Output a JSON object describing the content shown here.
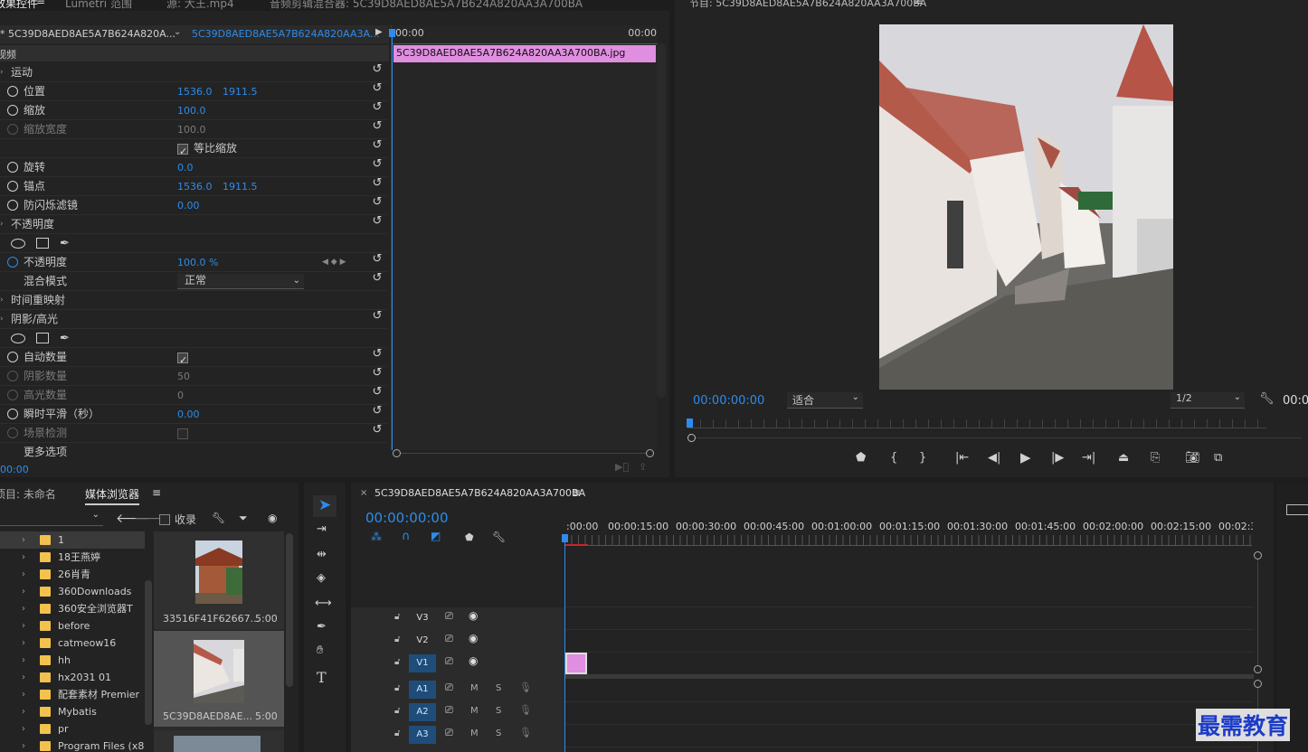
{
  "effect_controls": {
    "tabs": [
      "效果控件",
      "Lumetri 范围",
      "源: 大王.mp4",
      "音频剪辑混合器: 5C39D8AED8AE5A7B624A820AA3A700BA"
    ],
    "clip_header_left": "* 5C39D8AED8AE5A7B624A820A...",
    "clip_header_right": "5C39D8AED8AE5A7B624A820AA3A...",
    "section_video": "视频",
    "motion": "运动",
    "position_label": "位置",
    "position_x": "1536.0",
    "position_y": "1911.5",
    "scale_label": "缩放",
    "scale_value": "100.0",
    "scale_width_label": "缩放宽度",
    "scale_width_value": "100.0",
    "uniform_scale_label": "等比缩放",
    "rotation_label": "旋转",
    "rotation_value": "0.0",
    "anchor_label": "锚点",
    "anchor_x": "1536.0",
    "anchor_y": "1911.5",
    "antiflicker_label": "防闪烁滤镜",
    "antiflicker_value": "0.00",
    "opacity_section": "不透明度",
    "opacity_label": "不透明度",
    "opacity_value": "100.0 %",
    "blend_label": "混合模式",
    "blend_value": "正常",
    "time_remap": "时间重映射",
    "shadow_highlight": "阴影/高光",
    "auto_amount_label": "自动数量",
    "shadow_amount_label": "阴影数量",
    "shadow_amount_value": "50",
    "highlight_amount_label": "高光数量",
    "highlight_amount_value": "0",
    "temporal_smooth_label": "瞬时平滑（秒）",
    "temporal_smooth_value": "0.00",
    "scene_detect_label": "场景检测",
    "more_options_label": "更多选项",
    "footer_time": "00:00",
    "mini_timeline": {
      "start": "00:00",
      "end": "00:00",
      "clip_name": "5C39D8AED8AE5A7B624A820AA3A700BA.jpg"
    }
  },
  "program_monitor": {
    "title": "节目: 5C39D8AED8AE5A7B624A820AA3A700BA",
    "timecode": "00:00:00:00",
    "fit_label": "适合",
    "resolution": "1/2",
    "timecode_right": "00:0"
  },
  "project": {
    "tab_project": "项目: 未命名",
    "tab_media_browser": "媒体浏览器",
    "favorites_label": "收录",
    "folders": [
      "1",
      "18王燕婷",
      "26肖青",
      "360Downloads",
      "360安全浏览器T",
      "before",
      "catmeow16",
      "hh",
      "hx2031 01",
      "配套素材 Premier",
      "Mybatis",
      "pr",
      "Program Files (x86"
    ],
    "thumbs": [
      {
        "name": "33516F41F62667...",
        "duration": "5:00"
      },
      {
        "name": "5C39D8AED8AE...",
        "duration": "5:00"
      }
    ]
  },
  "timeline": {
    "sequence_name": "5C39D8AED8AE5A7B624A820AA3A700BA",
    "timecode": "00:00:00:00",
    "ruler": [
      ":00:00",
      "00:00:15:00",
      "00:00:30:00",
      "00:00:45:00",
      "00:01:00:00",
      "00:01:15:00",
      "00:01:30:00",
      "00:01:45:00",
      "00:02:00:00",
      "00:02:15:00",
      "00:02:3"
    ],
    "video_tracks": [
      "V3",
      "V2",
      "V1"
    ],
    "audio_tracks": [
      "A1",
      "A2",
      "A3"
    ],
    "mute_label": "M",
    "solo_label": "S"
  },
  "watermark": "最需教育",
  "colors": {
    "clip_pink": "#e08ee0",
    "accent_blue": "#2d8ceb",
    "selected_track": "#1f4d7a",
    "watermark_blue": "#1d3cc8"
  }
}
